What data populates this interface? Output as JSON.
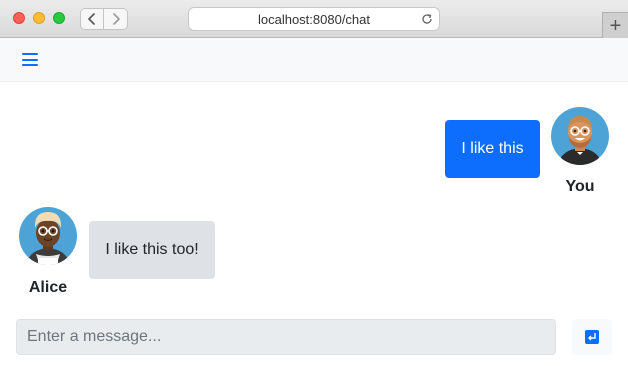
{
  "browser": {
    "url": "localhost:8080/chat",
    "new_tab_label": "+"
  },
  "app": {
    "accent_color": "#0d6efd",
    "menu_icon": "hamburger-menu-icon"
  },
  "messages": [
    {
      "author": "You",
      "text": "I like this",
      "side": "right",
      "bubble_color": "#0d6efd"
    },
    {
      "author": "Alice",
      "text": "I like this too!",
      "side": "left",
      "bubble_color": "#dee2e6"
    }
  ],
  "composer": {
    "placeholder": "Enter a message...",
    "value": "",
    "send_icon": "send-enter-icon"
  }
}
